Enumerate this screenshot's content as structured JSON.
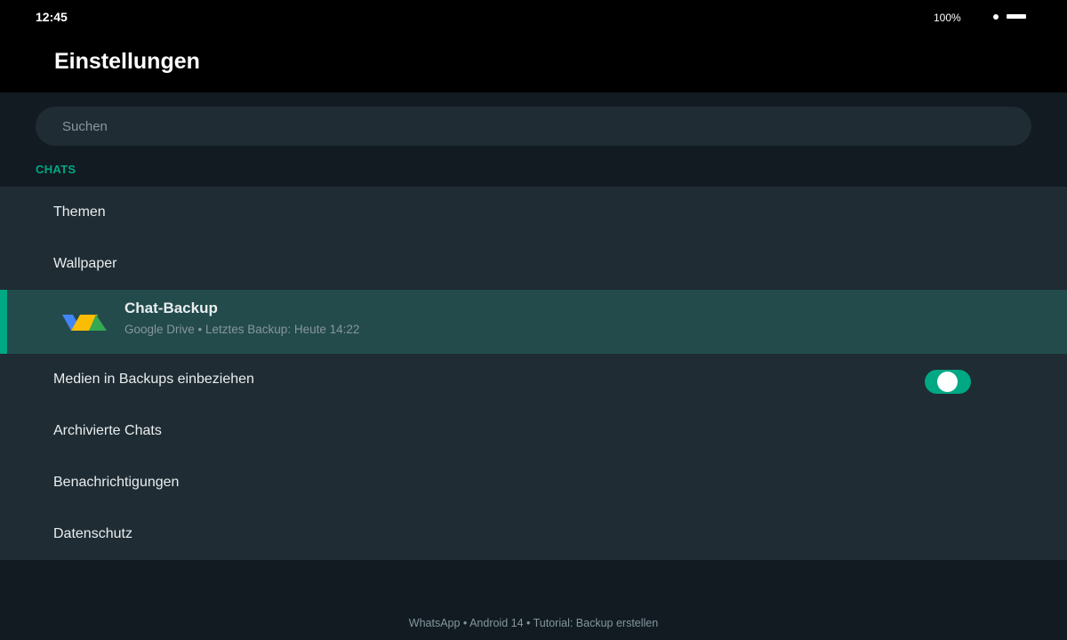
{
  "status_bar": {
    "time": "12:45",
    "battery": "100%"
  },
  "header": {
    "title": "Einstellungen"
  },
  "search": {
    "placeholder": "Suchen"
  },
  "section": {
    "heading": "CHATS"
  },
  "settings": {
    "themes": "Themen",
    "wallpaper": "Wallpaper",
    "backup": {
      "title": "Chat-Backup",
      "subtitle": "Google Drive • Letztes Backup: Heute 14:22",
      "icon": "google-drive-icon"
    },
    "media_in_backups": {
      "label": "Medien in Backups einbeziehen",
      "enabled": true
    },
    "archived": "Archivierte Chats",
    "notifications": "Benachrichtigungen",
    "privacy": "Datenschutz"
  },
  "footer": {
    "caption": "WhatsApp • Android 14 • Tutorial: Backup erstellen"
  },
  "colors": {
    "accent": "#00a884",
    "background": "#111b21",
    "row_background": "#1f2c33",
    "selected_row": "#234b4b"
  }
}
